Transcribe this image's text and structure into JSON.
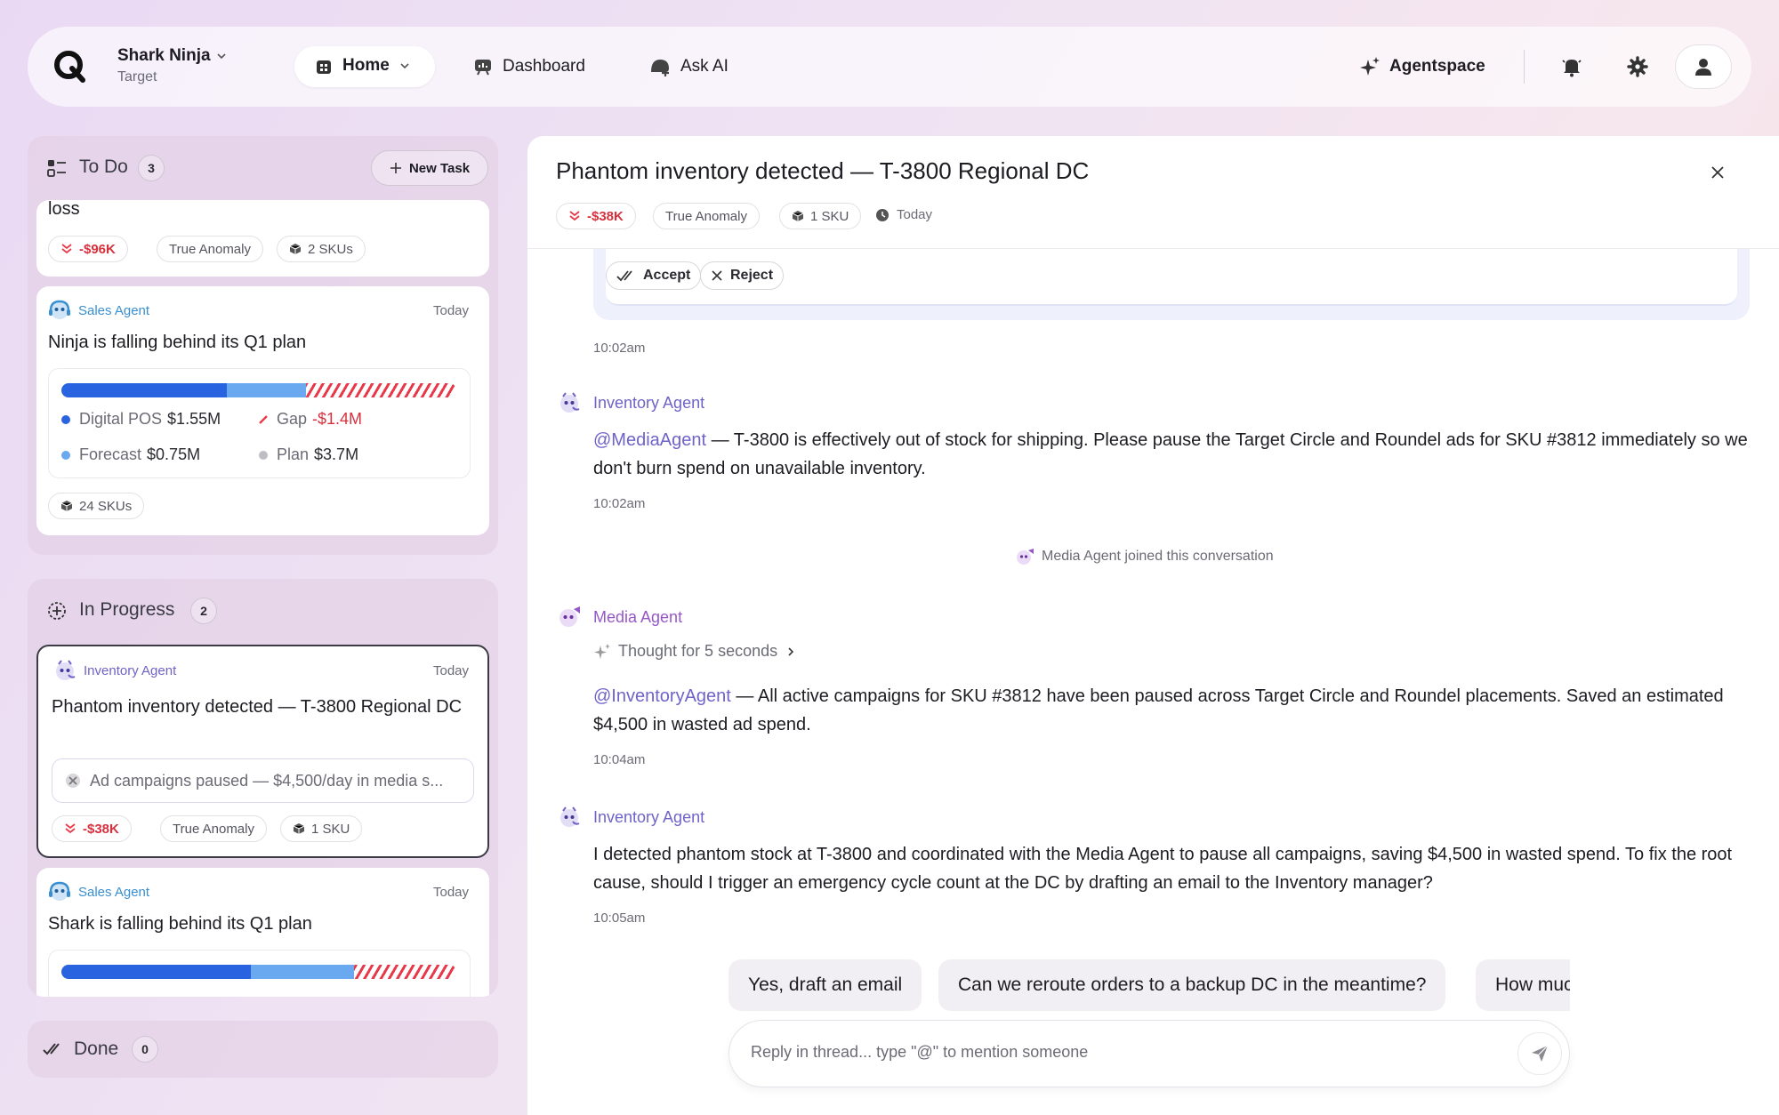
{
  "topbar": {
    "brand": "Shark Ninja",
    "brand_sub": "Target",
    "nav": {
      "home": "Home",
      "dashboard": "Dashboard",
      "ask_ai": "Ask AI"
    },
    "agentspace": "Agentspace"
  },
  "todo": {
    "title": "To Do",
    "count": "3",
    "new_task": "New Task",
    "card1": {
      "title_tail": "loss",
      "tags": {
        "amount": "-$96K",
        "type": "True Anomaly",
        "skus": "2 SKUs"
      }
    },
    "card2": {
      "agent": "Sales Agent",
      "date": "Today",
      "title": "Ninja is falling behind its Q1 plan",
      "chart": {
        "pos_share": 0.42,
        "forecast_share": 0.2,
        "legend": {
          "pos_label": "Digital POS",
          "pos_value": "$1.55M",
          "gap_label": "Gap",
          "gap_value": "-$1.4M",
          "fc_label": "Forecast",
          "fc_value": "$0.75M",
          "plan_label": "Plan",
          "plan_value": "$3.7M"
        }
      },
      "skus": "24 SKUs"
    }
  },
  "in_progress": {
    "title": "In Progress",
    "count": "2",
    "card1": {
      "agent": "Inventory Agent",
      "date": "Today",
      "title": "Phantom inventory detected — T-3800 Regional DC",
      "snippet": "Ad campaigns paused — $4,500/day in media s...",
      "tags": {
        "amount": "-$38K",
        "type": "True Anomaly",
        "skus": "1 SKU"
      }
    },
    "card2": {
      "agent": "Sales Agent",
      "date": "Today",
      "title": "Shark is falling behind its Q1 plan",
      "chart": {
        "pos_share": 0.48,
        "forecast_share": 0.26
      }
    }
  },
  "done": {
    "title": "Done",
    "count": "0"
  },
  "thread": {
    "title": "Phantom inventory detected — T-3800 Regional DC",
    "tags": {
      "amount": "-$38K",
      "type": "True Anomaly",
      "skus": "1 SKU",
      "date": "Today"
    },
    "actions": {
      "accept": "Accept",
      "reject": "Reject"
    },
    "time0": "10:02am",
    "msg1": {
      "sender": "Inventory Agent",
      "mention": "@MediaAgent",
      "text": " — T-3800 is effectively out of stock for shipping. Please pause the Target Circle and Roundel ads for SKU #3812 immediately so we don't burn spend on unavailable inventory.",
      "time": "10:02am"
    },
    "system_note": "Media Agent joined this conversation",
    "msg2": {
      "sender": "Media Agent",
      "thought": "Thought for 5 seconds",
      "mention": "@InventoryAgent",
      "text": " — All active campaigns for SKU #3812 have been paused across Target Circle and Roundel placements. Saved an estimated $4,500 in wasted ad spend.",
      "time": "10:04am"
    },
    "msg3": {
      "sender": "Inventory Agent",
      "text": "I detected phantom stock at T-3800 and coordinated with the Media Agent to pause all campaigns, saving $4,500 in wasted spend. To fix the root cause, should I trigger an emergency cycle count at the DC by drafting an email to the Inventory manager?",
      "time": "10:05am"
    },
    "suggestions": [
      "Yes, draft an email",
      "Can we reroute orders to a backup DC in the meantime?",
      "How much"
    ],
    "reply_placeholder": "Reply in thread... type \"@\" to mention someone"
  },
  "colors": {
    "accent_purple": "#6f63c8",
    "sales_blue": "#3a8fd1",
    "negative_red": "#d8313e",
    "pos_blue": "#2a63e0",
    "forecast_blue": "#6aa8f0"
  }
}
